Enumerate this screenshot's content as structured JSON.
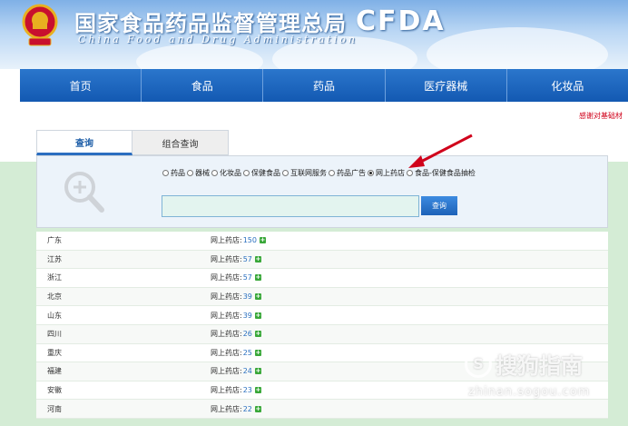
{
  "header": {
    "title": "国家食品药品监督管理总局",
    "subtitle": "China Food and Drug Administration",
    "logo_text": "CFDA"
  },
  "nav": {
    "items": [
      "首页",
      "食品",
      "药品",
      "医疗器械",
      "化妆品"
    ]
  },
  "thanks_link": "感谢对基础材",
  "tabs": {
    "query": "查询",
    "combined_query": "组合查询"
  },
  "search": {
    "options": [
      {
        "label": "药品",
        "checked": false
      },
      {
        "label": "器械",
        "checked": false
      },
      {
        "label": "化妆品",
        "checked": false
      },
      {
        "label": "保健食品",
        "checked": false
      },
      {
        "label": "互联网服务",
        "checked": false
      },
      {
        "label": "药品广告",
        "checked": false
      },
      {
        "label": "网上药店",
        "checked": true
      },
      {
        "label": "食品-保健食品抽检",
        "checked": false
      }
    ],
    "input_value": "",
    "button_label": "查询"
  },
  "results": [
    {
      "province": "广东",
      "label": "网上药店:",
      "count": "150"
    },
    {
      "province": "江苏",
      "label": "网上药店:",
      "count": "57"
    },
    {
      "province": "浙江",
      "label": "网上药店:",
      "count": "57"
    },
    {
      "province": "北京",
      "label": "网上药店:",
      "count": "39"
    },
    {
      "province": "山东",
      "label": "网上药店:",
      "count": "39"
    },
    {
      "province": "四川",
      "label": "网上药店:",
      "count": "26"
    },
    {
      "province": "重庆",
      "label": "网上药店:",
      "count": "25"
    },
    {
      "province": "福建",
      "label": "网上药店:",
      "count": "24"
    },
    {
      "province": "安徽",
      "label": "网上药店:",
      "count": "23"
    },
    {
      "province": "河南",
      "label": "网上药店:",
      "count": "22"
    }
  ],
  "watermark": {
    "logo_char": "S",
    "name": "搜狗指南",
    "url": "zhinan.sogou.com"
  },
  "colors": {
    "nav_blue": "#1359b2",
    "accent_red": "#d0021b",
    "count_blue": "#2a70c0",
    "plus_green": "#3aa83a",
    "band_green": "#d4ecd5"
  }
}
